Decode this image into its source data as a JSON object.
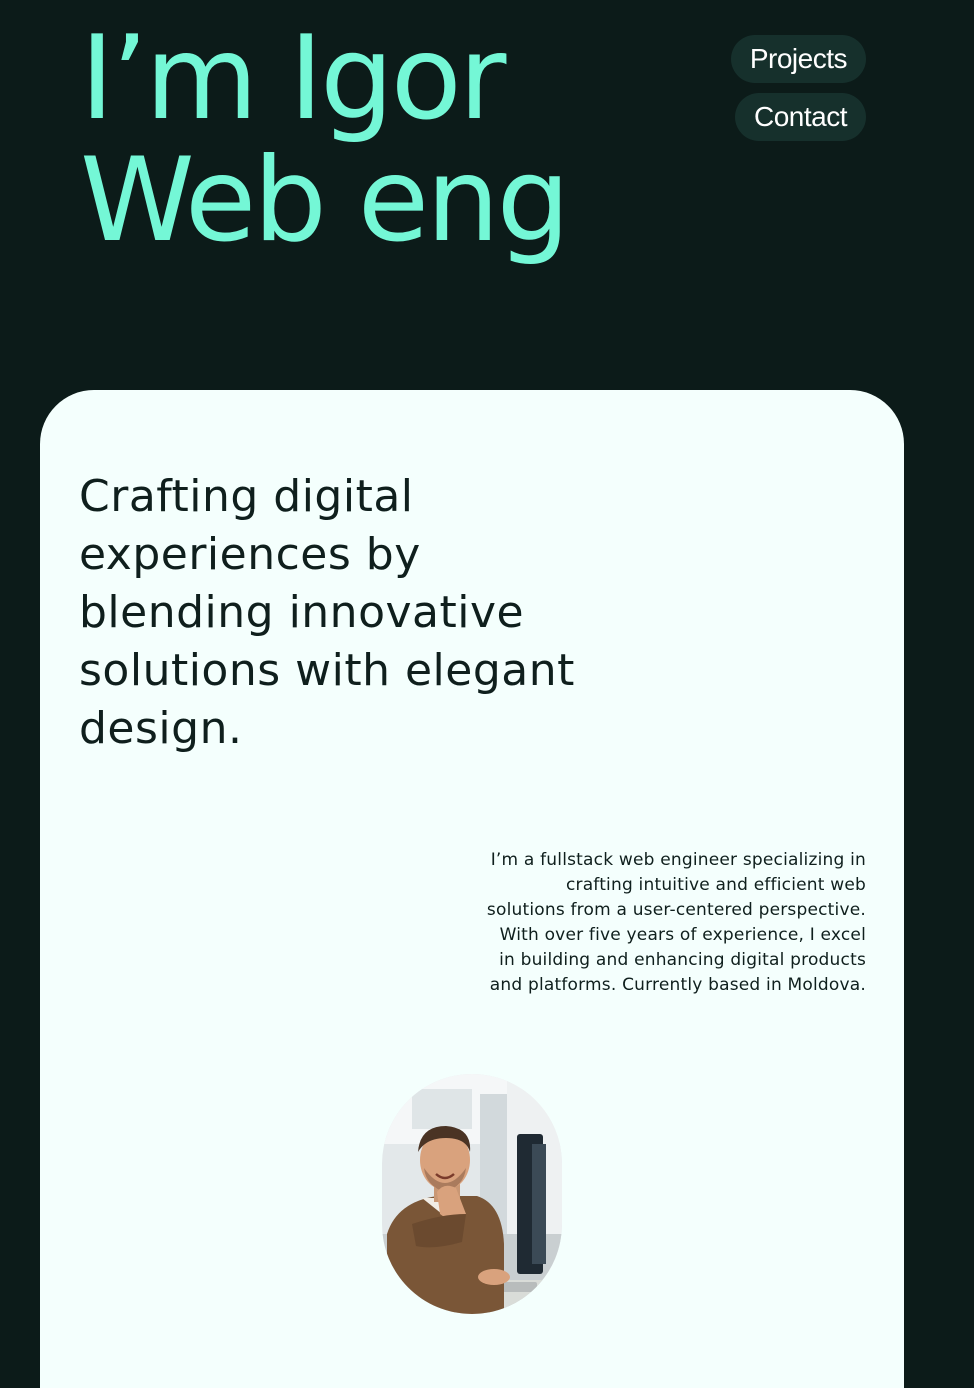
{
  "hero": {
    "line1": "I’m Igor",
    "line2": "Web eng"
  },
  "nav": {
    "projects_label": "Projects",
    "contact_label": "Contact"
  },
  "about": {
    "tagline": "Crafting digital experiences by blending innovative solutions with elegant design.",
    "bio": "I’m a fullstack web engineer specializing in crafting intuitive and efficient web solutions from a user-centered perspective. With over five years of experience, I excel in building and enhancing digital products and platforms. Currently based in Moldova."
  },
  "colors": {
    "background": "#0c1b19",
    "accent": "#74f7d6",
    "card": "#f4fffd",
    "nav_pill": "#16302c"
  }
}
